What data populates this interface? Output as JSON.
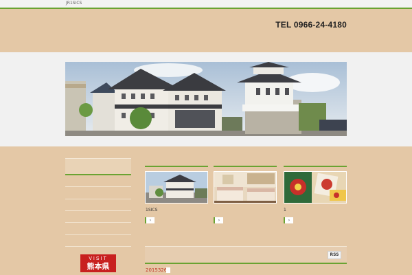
{
  "topbar": {
    "crumb": "JR1SICS"
  },
  "header": {
    "tel": "TEL 0966-24-4180"
  },
  "sidebar": {
    "banner_line1": "VISIT",
    "banner_line2": "熊本県"
  },
  "cards": [
    {
      "caption": "1SICS",
      "button": "›"
    },
    {
      "caption": "",
      "button": "›"
    },
    {
      "caption": "1",
      "button": "›"
    }
  ],
  "news": {
    "rss_label": "RSS",
    "date": "2015326"
  },
  "colors": {
    "accent": "#6aa332",
    "background": "#e4c8a6",
    "banner": "#c8201f"
  }
}
